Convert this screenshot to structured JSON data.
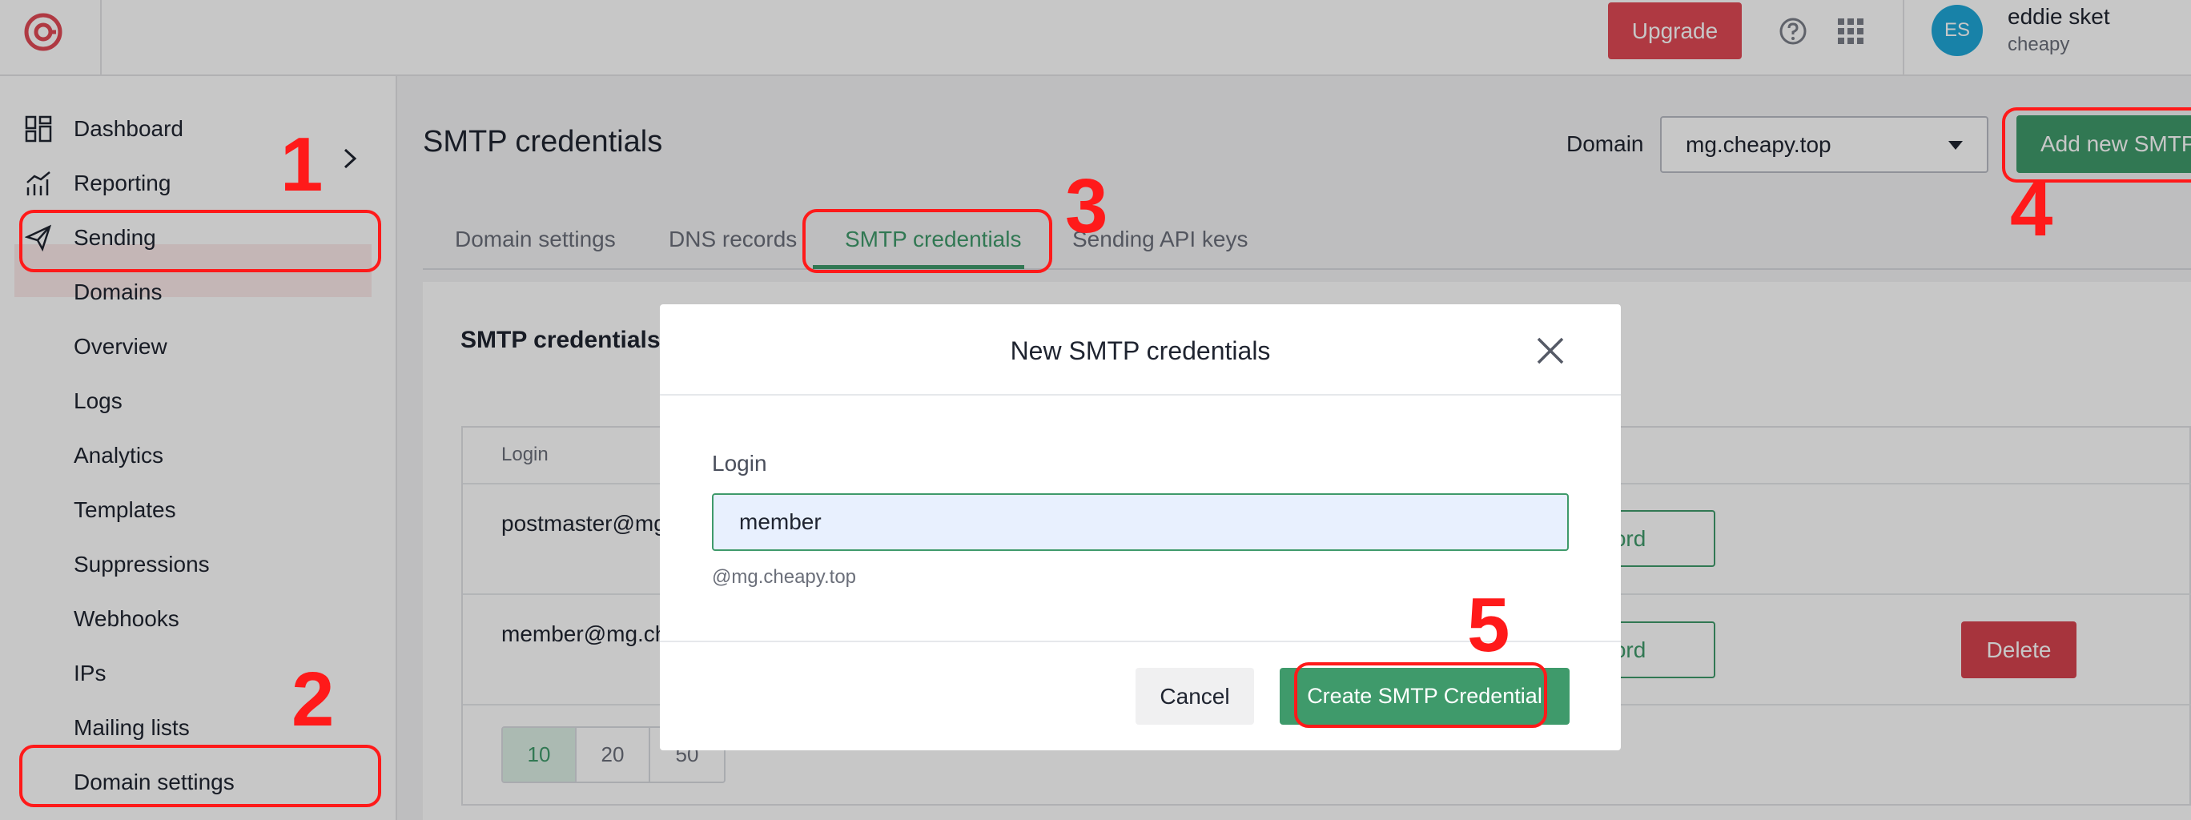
{
  "topbar": {
    "upgrade_label": "Upgrade",
    "user": {
      "initials": "ES",
      "name": "eddie sket",
      "org": "cheapy"
    }
  },
  "sidebar": {
    "items": [
      {
        "label": "Dashboard",
        "icon": "dashboard-icon"
      },
      {
        "label": "Reporting",
        "icon": "reporting-icon"
      },
      {
        "label": "Sending",
        "icon": "send-icon"
      }
    ],
    "sub_items": [
      "Domains",
      "Overview",
      "Logs",
      "Analytics",
      "Templates",
      "Suppressions",
      "Webhooks",
      "IPs",
      "Mailing lists",
      "Domain settings"
    ]
  },
  "main": {
    "page_title": "SMTP credentials",
    "domain_label": "Domain",
    "domain_value": "mg.cheapy.top",
    "add_button": "Add new SMTP",
    "tabs": [
      "Domain settings",
      "DNS records",
      "SMTP credentials",
      "Sending API keys"
    ],
    "active_tab": "SMTP credentials",
    "card_title": "SMTP credentials",
    "table": {
      "login_header": "Login",
      "rows": [
        {
          "login": "postmaster@mg",
          "pw_button": "ssword"
        },
        {
          "login": "member@mg.ch",
          "pw_button": "ssword",
          "delete_button": "Delete"
        }
      ]
    },
    "pager": [
      "10",
      "20",
      "50"
    ]
  },
  "modal": {
    "title": "New SMTP credentials",
    "login_label": "Login",
    "login_value": "member",
    "login_hint": "@mg.cheapy.top",
    "cancel_label": "Cancel",
    "create_label": "Create SMTP Credential"
  },
  "annotations": {
    "color": "#ff1a1a",
    "steps": [
      "1",
      "2",
      "3",
      "4",
      "5"
    ]
  },
  "colors": {
    "brand_green": "#3f9a6b",
    "danger_red": "#d6434f",
    "upgrade_red": "#e14a55"
  }
}
